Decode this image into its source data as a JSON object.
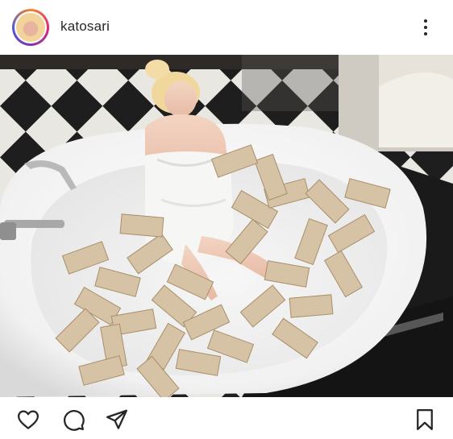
{
  "post": {
    "username": "katosari"
  },
  "icons": {
    "avatar": "profile-picture",
    "more": "more-options-icon",
    "like": "heart-icon",
    "comment": "comment-icon",
    "share": "send-icon",
    "save": "bookmark-icon"
  }
}
